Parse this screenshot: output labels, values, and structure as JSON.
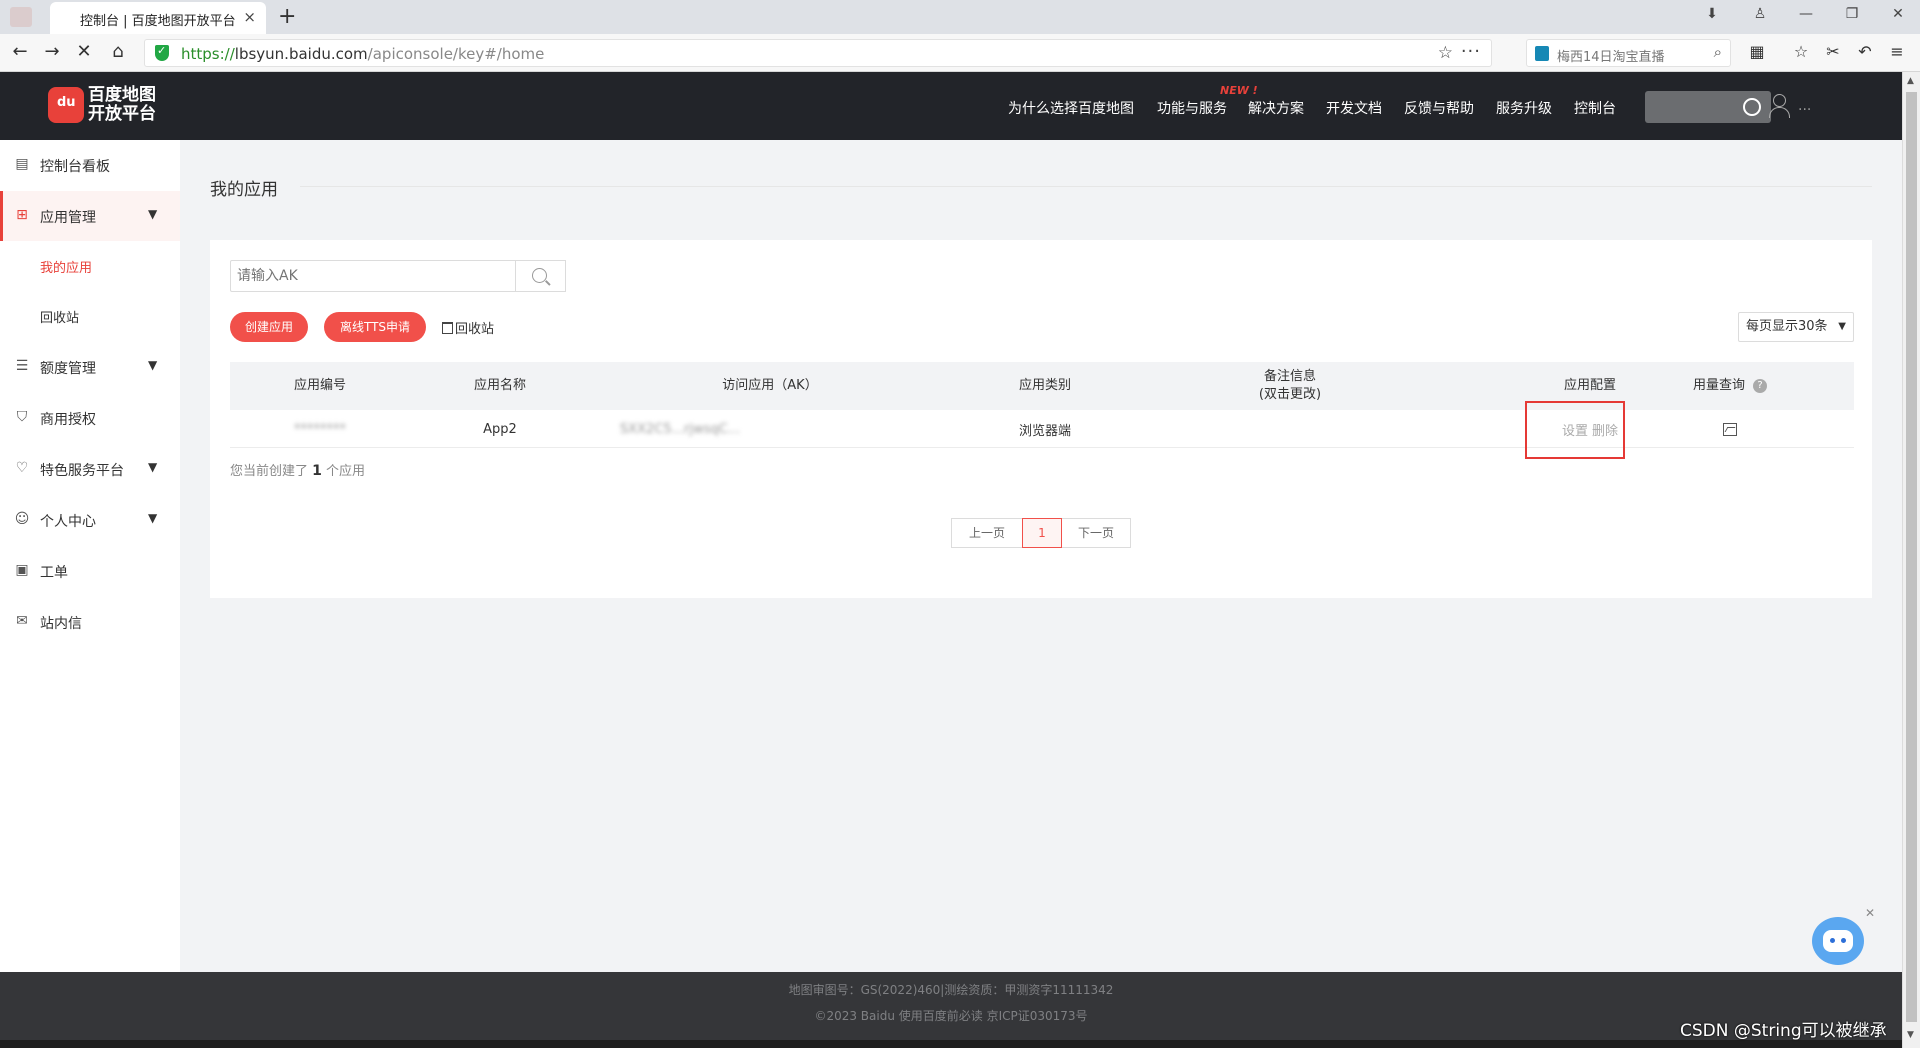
{
  "browser": {
    "tab_title": "控制台 | 百度地图开放平台",
    "tab_close": "×",
    "new_tab": "+",
    "url_scheme": "https://",
    "url_host": "lbsyun.baidu.com",
    "url_path": "/apiconsole/key#/home",
    "search_text": "梅西14日淘宝直播"
  },
  "site": {
    "logo_line1": "百度地图",
    "logo_line2": "开放平台",
    "new_badge": "NEW !",
    "nav": [
      "为什么选择百度地图",
      "功能与服务",
      "解决方案",
      "开发文档",
      "反馈与帮助",
      "服务升级",
      "控制台"
    ],
    "user_name": "...",
    "accent_color": "#e8413a"
  },
  "sidebar": {
    "items": [
      {
        "label": "控制台看板",
        "icon": "dashboard-icon"
      },
      {
        "label": "应用管理",
        "icon": "grid-icon"
      },
      {
        "label": "额度管理",
        "icon": "sliders-icon"
      },
      {
        "label": "商用授权",
        "icon": "shield-check-icon"
      },
      {
        "label": "特色服务平台",
        "icon": "heart-icon"
      },
      {
        "label": "个人中心",
        "icon": "user-circle-icon"
      },
      {
        "label": "工单",
        "icon": "clipboard-icon"
      },
      {
        "label": "站内信",
        "icon": "mail-icon"
      }
    ],
    "sub_items": [
      "我的应用",
      "回收站"
    ]
  },
  "main": {
    "page_title": "我的应用",
    "search_placeholder": "请输入AK",
    "create_button": "创建应用",
    "tts_button": "离线TTS申请",
    "recycle_label": "回收站",
    "per_page": "每页显示30条",
    "table": {
      "headers": [
        "应用编号",
        "应用名称",
        "访问应用（AK）",
        "应用类别",
        "备注信息",
        "(双击更改)",
        "应用配置",
        "用量查询"
      ],
      "rows": [
        {
          "id": "********",
          "name": "App2",
          "ak": "SXX2C5...rjwsqC...",
          "category": "浏览器端",
          "note": "",
          "settings": "设置",
          "delete": "删除"
        }
      ]
    },
    "summary_prefix": "您当前创建了",
    "summary_count": "1",
    "summary_suffix": "个应用",
    "pager": {
      "prev": "上一页",
      "current": "1",
      "next": "下一页"
    }
  },
  "footer": {
    "line1": "地图审图号：GS(2022)460|测绘资质：甲测资字11111342",
    "line2": "©2023 Baidu 使用百度前必读 京ICP证030173号"
  },
  "watermark": "CSDN @String可以被继承"
}
